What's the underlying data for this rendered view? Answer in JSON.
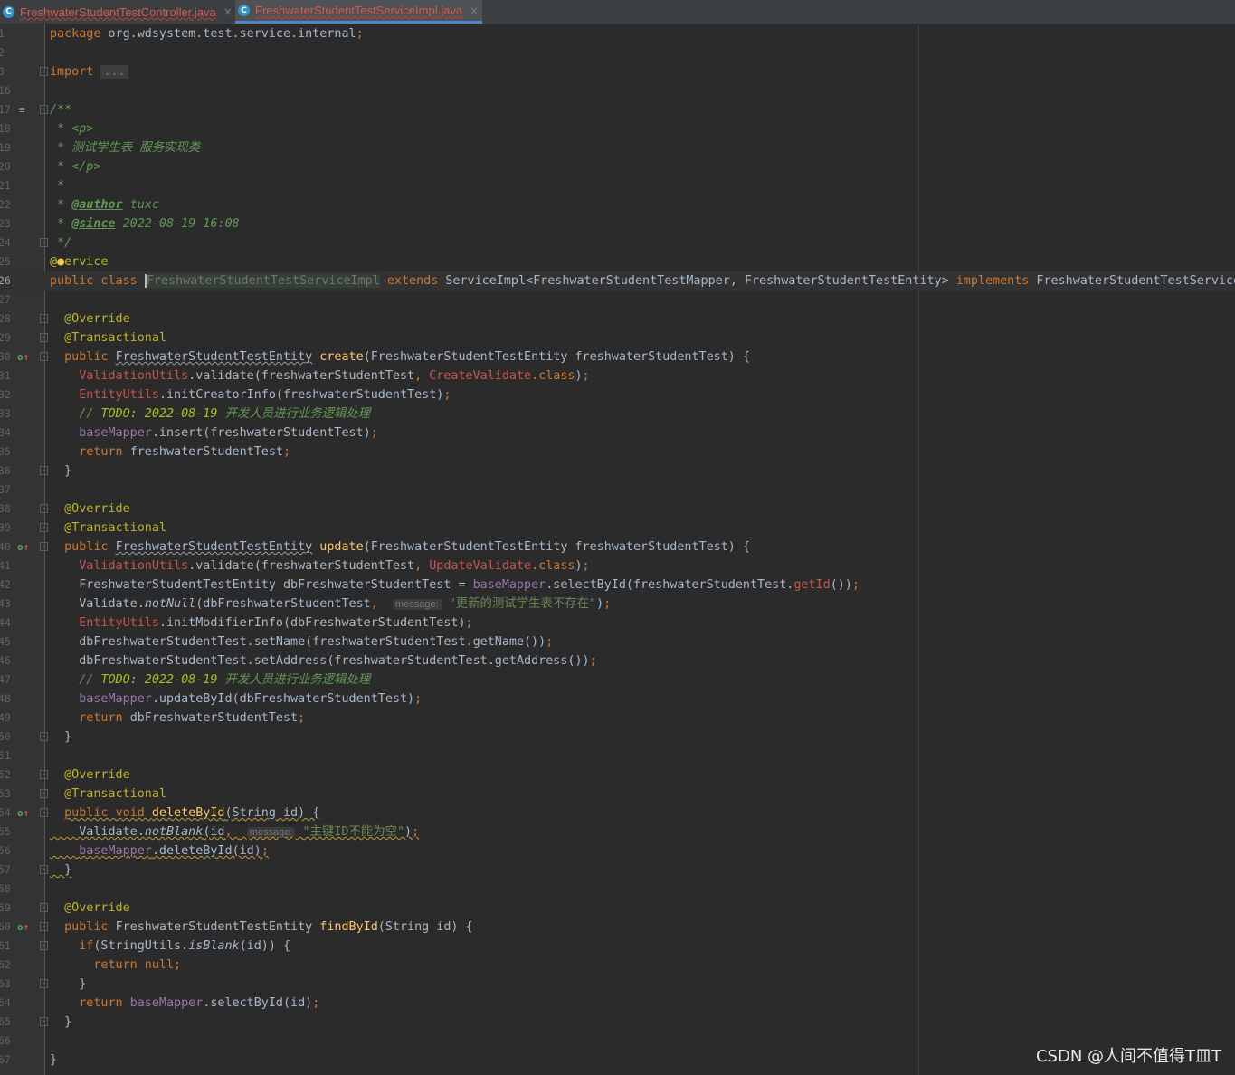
{
  "tabs": [
    {
      "label": "FreshwaterStudentTestController.java",
      "icon": "java-class-icon",
      "icon_letter": "C",
      "active": false
    },
    {
      "label": "FreshwaterStudentTestServiceImpl.java",
      "icon": "java-class-icon",
      "icon_letter": "C",
      "active": true
    }
  ],
  "close_glyph": "×",
  "editor": {
    "line_numbers": [
      "1",
      "2",
      "3",
      "16",
      "17",
      "18",
      "19",
      "20",
      "21",
      "22",
      "23",
      "24",
      "25",
      "26",
      "27",
      "28",
      "29",
      "30",
      "31",
      "32",
      "33",
      "34",
      "35",
      "36",
      "37",
      "38",
      "39",
      "40",
      "41",
      "42",
      "43",
      "44",
      "45",
      "46",
      "47",
      "48",
      "49",
      "50",
      "51",
      "52",
      "53",
      "54",
      "55",
      "56",
      "57",
      "58",
      "59",
      "60",
      "61",
      "62",
      "63",
      "64",
      "65",
      "66",
      "67"
    ],
    "current_line": "26",
    "code": {
      "package_kw": "package",
      "package_name": "org.wdsystem.test.service.internal",
      "import_kw": "import",
      "import_folded": "...",
      "doc_open": "/**",
      "doc_p_open": " * <p>",
      "doc_desc": " * 测试学生表 服务实现类",
      "doc_p_close": " * </p>",
      "doc_blank": " *",
      "doc_author_tag": "@author",
      "doc_author": "tuxc",
      "doc_since_tag": "@since",
      "doc_since": "2022-08-19 16:08",
      "doc_close": " */",
      "service_ann": "@Service",
      "class_name": "FreshwaterStudentTestServiceImpl",
      "parent_class": "ServiceImpl<FreshwaterStudentTestMapper, FreshwaterStudentTestEntity>",
      "interface": "FreshwaterStudentTestService",
      "override": "@Override",
      "transactional": "@Transactional",
      "entity_type": "FreshwaterStudentTestEntity",
      "param": "freshwaterStudentTest",
      "db_var": "dbFreshwaterStudentTest",
      "todo_prefix": "// ",
      "todo": "TODO: 2022-08-19",
      "todo_text": "开发人员进行业务逻辑处理",
      "hint_message": "message:",
      "msg_not_exist": "\"更新的测试学生表不存在\"",
      "msg_id_blank": "\"主键ID不能为空\""
    }
  },
  "watermark": "CSDN @人间不值得T皿T"
}
